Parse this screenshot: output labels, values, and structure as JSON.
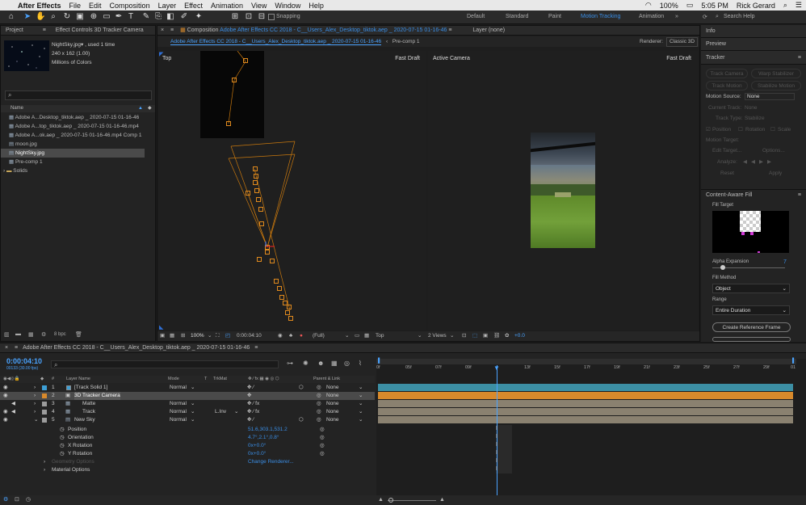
{
  "menubar": {
    "app": "After Effects",
    "items": [
      "File",
      "Edit",
      "Composition",
      "Layer",
      "Effect",
      "Animation",
      "View",
      "Window",
      "Help"
    ],
    "battery": "100%",
    "time": "5:05 PM",
    "user": "Rick Gerard"
  },
  "toolbar": {
    "snapping": "Snapping",
    "workspaces": [
      "Default",
      "Standard",
      "Paint",
      "Motion Tracking",
      "Animation"
    ],
    "active_workspace": "Motion Tracking",
    "search_placeholder": "Search Help"
  },
  "project": {
    "tab": "Project",
    "effect_tab": "Effect Controls 3D Tracker Camera",
    "preview_name": "NightSky.jpg▾ , used 1 time",
    "preview_dims": "240 x 162 (1.00)",
    "preview_colors": "Millions of Colors",
    "name_header": "Name",
    "items": [
      "Adobe A...Desktop_tiktok.aep _ 2020-07-15 01-16-46",
      "Adobe A...top_tiktok.aep _ 2020-07-15 01-16-46.mp4",
      "Adobe A...ok.aep _ 2020-07-15 01-16-46.mp4 Comp 1",
      "moon.jpg",
      "NightSky.jpg",
      "Pre-comp 1",
      "Solids"
    ],
    "bpc": "8 bpc"
  },
  "comp": {
    "tab_prefix": "Composition",
    "tab_name": "Adobe After Effects CC 2018 - C__Users_Alex_Desktop_tiktok.aep _ 2020-07-15 01-16-46",
    "layer_tab": "Layer (none)",
    "sub_tab": "Adobe After Effects CC 2018 - C__Users_Alex_Desktop_tiktok.aep _ 2020-07-15 01-16-46",
    "precomp_tab": "Pre-comp 1",
    "renderer": "Renderer:",
    "renderer_value": "Classic 3D",
    "left_view": "Top",
    "left_quality": "Fast Draft",
    "right_view": "Active Camera",
    "right_quality": "Fast Draft",
    "zoom": "100%",
    "timecode": "0:00:04:10",
    "resolution": "(Full)",
    "view_select": "Top",
    "views": "2 Views",
    "exposure": "+0.0"
  },
  "right": {
    "info": "Info",
    "preview": "Preview",
    "tracker": "Tracker",
    "track_camera": "Track Camera",
    "warp_stabilizer": "Warp Stabilizer",
    "track_motion": "Track Motion",
    "stabilize_motion": "Stabilize Motion",
    "motion_source_label": "Motion Source:",
    "motion_source_value": "None",
    "current_track": "Current Track:",
    "current_track_value": "None",
    "track_type": "Track Type:",
    "track_type_value": "Stabilize",
    "position": "Position",
    "rotation": "Rotation",
    "scale": "Scale",
    "motion_target": "Motion Target:",
    "edit_target": "Edit Target...",
    "options": "Options...",
    "analyze": "Analyze:",
    "reset": "Reset",
    "apply": "Apply",
    "caf": "Content-Aware Fill",
    "fill_target": "Fill Target",
    "alpha_expansion": "Alpha Expansion",
    "alpha_value": "7",
    "fill_method": "Fill Method",
    "fill_method_value": "Object",
    "range": "Range",
    "range_value": "Entire Duration",
    "create_ref": "Create Reference Frame"
  },
  "timeline": {
    "tab": "Adobe After Effects CC 2018 - C__Users_Alex_Desktop_tiktok.aep _ 2020-07-15 01-16-46",
    "timecode": "0:00:04:10",
    "fps": "00133 (30.00 fps)",
    "col_num": "#",
    "col_layer": "Layer Name",
    "col_mode": "Mode",
    "col_t": "T",
    "col_trkmat": "TrkMat",
    "col_parent": "Parent & Link",
    "layers": [
      {
        "num": "1",
        "name": "[Track Solid 1]",
        "mode": "Normal",
        "trkmat": "",
        "parent": "None",
        "color": "#3d9fd6"
      },
      {
        "num": "2",
        "name": "3D Tracker Camera",
        "mode": "",
        "trkmat": "",
        "parent": "None",
        "color": "#d88a2c"
      },
      {
        "num": "3",
        "name": "Matte",
        "mode": "Normal",
        "trkmat": "",
        "parent": "None",
        "color": "#9c9c9c"
      },
      {
        "num": "4",
        "name": "Track",
        "mode": "Normal",
        "trkmat": "L.Inv",
        "parent": "None",
        "color": "#9c9c9c"
      },
      {
        "num": "5",
        "name": "New Sky",
        "mode": "Normal",
        "trkmat": "",
        "parent": "None",
        "color": "#9c9c9c"
      }
    ],
    "props": [
      {
        "name": "Position",
        "value": "51.6,303.1,531.2"
      },
      {
        "name": "Orientation",
        "value": "4.7°,2.1°,0.8°"
      },
      {
        "name": "X Rotation",
        "value": "0x+0.0°"
      },
      {
        "name": "Y Rotation",
        "value": "0x+0.0°"
      }
    ],
    "geometry": "Geometry Options",
    "change_renderer": "Change Renderer...",
    "material": "Material Options",
    "ruler": [
      "0f",
      "05f",
      "07f",
      "09f",
      "",
      "13f",
      "15f",
      "17f",
      "19f",
      "21f",
      "23f",
      "25f",
      "27f",
      "29f",
      "01"
    ]
  }
}
